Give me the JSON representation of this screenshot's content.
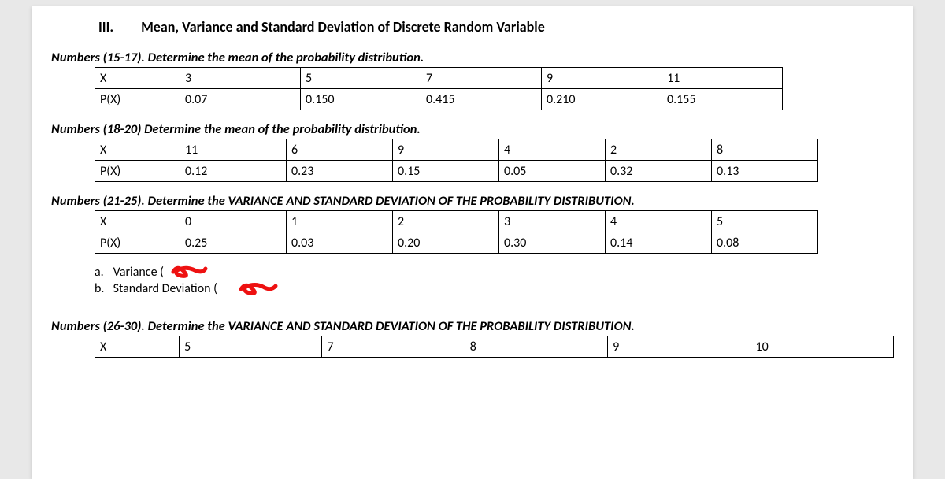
{
  "heading": {
    "roman": "III.",
    "title": "Mean, Variance and Standard Deviation of Discrete Random Variable"
  },
  "q1": {
    "prompt": "Numbers (15-17). Determine the mean of the probability distribution.",
    "rowlabels": {
      "x": "X",
      "p": "P(X)"
    },
    "x": [
      "3",
      "5",
      "7",
      "9",
      "11"
    ],
    "p": [
      "0.07",
      "0.150",
      "0.415",
      "0.210",
      "0.155"
    ]
  },
  "q2": {
    "prompt": "Numbers (18-20) Determine the mean of the probability distribution.",
    "rowlabels": {
      "x": "X",
      "p": "P(X)"
    },
    "x": [
      "11",
      "6",
      "9",
      "4",
      "2",
      "8"
    ],
    "p": [
      "0.12",
      "0.23",
      "0.15",
      "0.05",
      "0.32",
      "0.13"
    ]
  },
  "q3": {
    "prompt": "Numbers (21-25). Determine the VARIANCE AND STANDARD DEVIATION OF THE PROBABILITY DISTRIBUTION.",
    "rowlabels": {
      "x": "X",
      "p": "P(X)"
    },
    "x": [
      "0",
      "1",
      "2",
      "3",
      "4",
      "5"
    ],
    "p": [
      "0.25",
      "0.03",
      "0.20",
      "0.30",
      "0.14",
      "0.08"
    ],
    "answers": {
      "a_letter": "a.",
      "a_text": "Variance (",
      "b_letter": "b.",
      "b_text": "Standard Deviation ("
    }
  },
  "q4": {
    "prompt": "Numbers (26-30). Determine the VARIANCE AND STANDARD DEVIATION OF THE PROBABILITY DISTRIBUTION.",
    "rowlabels": {
      "x": "X"
    },
    "x": [
      "5",
      "7",
      "8",
      "9",
      "10"
    ]
  }
}
